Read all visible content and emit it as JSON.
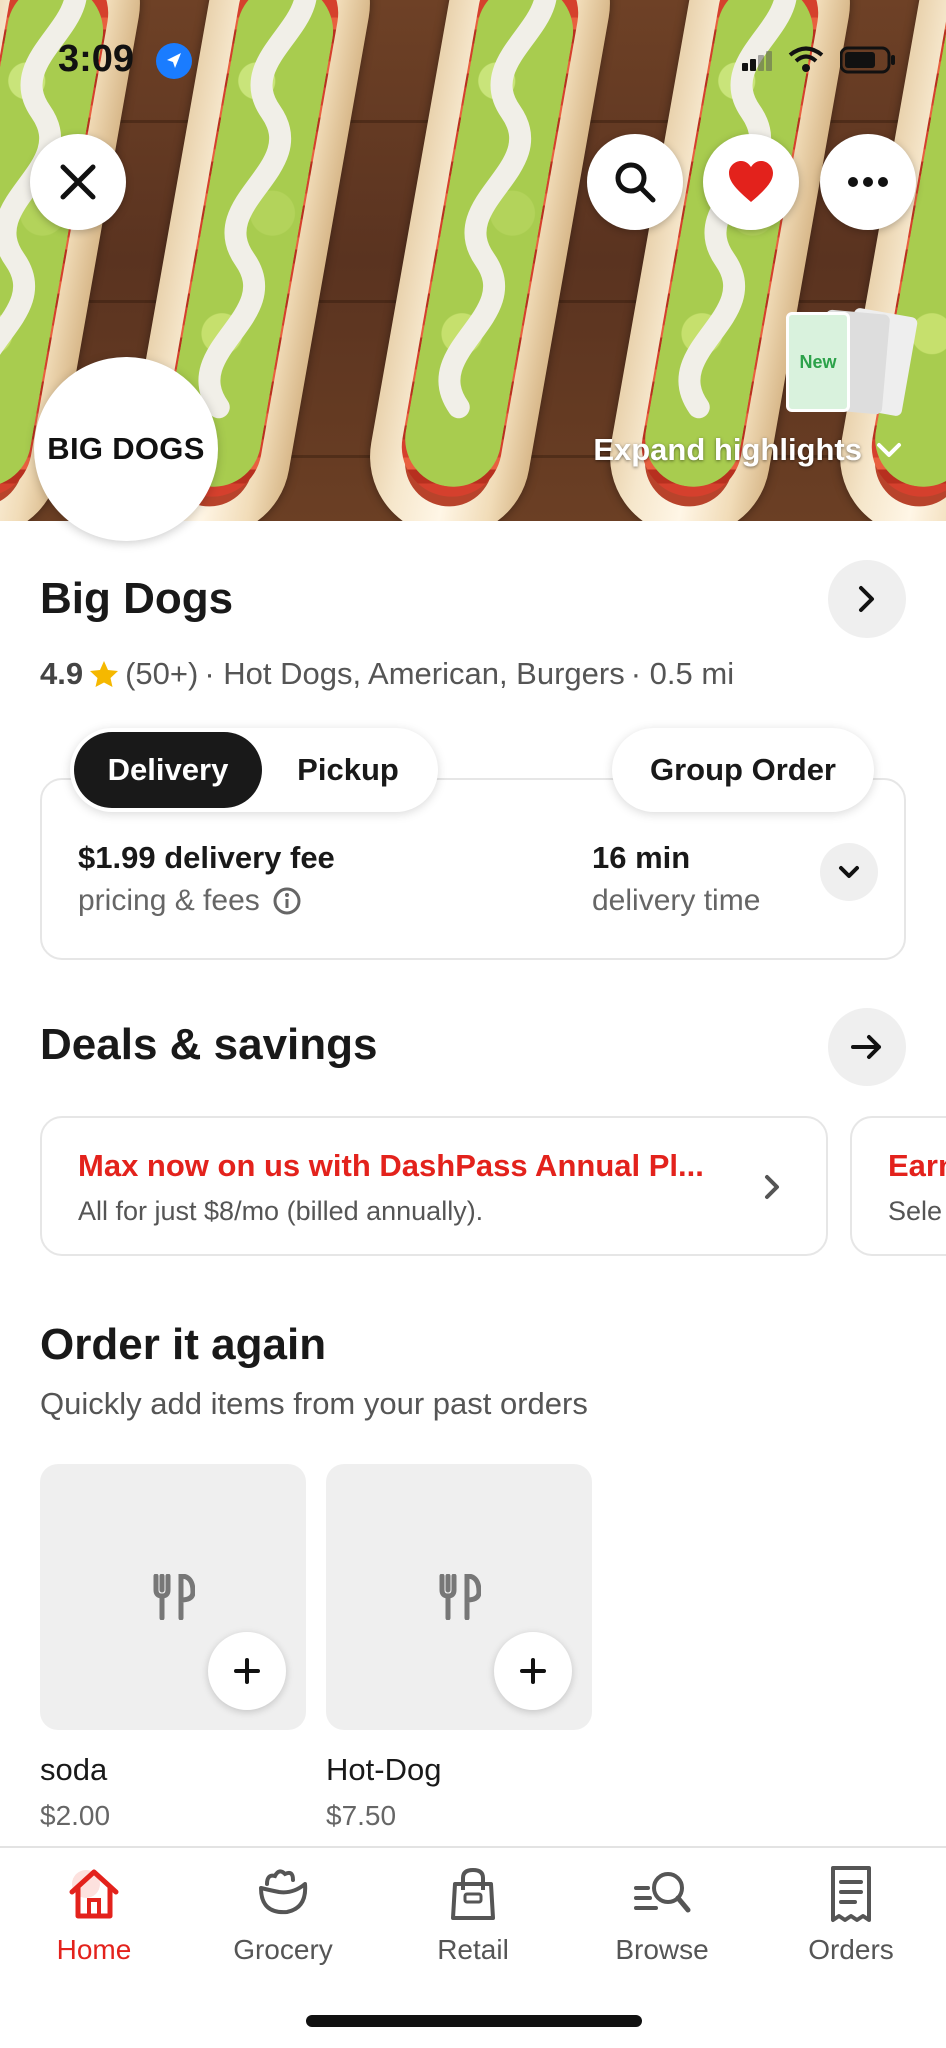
{
  "status_bar": {
    "time": "3:09"
  },
  "hero": {
    "close_icon": "close-icon",
    "search_icon": "search-icon",
    "favorite_icon": "heart-icon",
    "more_icon": "more-icon",
    "logo_text": "BIG DOGS",
    "new_badge": "New",
    "expand_label": "Expand highlights"
  },
  "store": {
    "name": "Big Dogs",
    "rating": "4.9",
    "reviews": "(50+)",
    "cuisines": "· Hot Dogs, American, Burgers",
    "distance": "· 0.5 mi"
  },
  "fulfillment": {
    "delivery_label": "Delivery",
    "pickup_label": "Pickup",
    "group_order_label": "Group Order",
    "fee": "$1.99 delivery fee",
    "fee_sub": "pricing & fees",
    "time": "16 min",
    "time_sub": "delivery time"
  },
  "deals": {
    "title": "Deals & savings",
    "cards": [
      {
        "title": "Max now on us with DashPass Annual Pl...",
        "subtitle": "All for just $8/mo (billed annually)."
      },
      {
        "title": "Earn",
        "subtitle": "Sele"
      }
    ]
  },
  "order_again": {
    "title": "Order it again",
    "subtitle": "Quickly add items from your past orders",
    "items": [
      {
        "name": "soda",
        "price": "$2.00"
      },
      {
        "name": "Hot-Dog",
        "price": "$7.50"
      }
    ]
  },
  "tabbar": {
    "tabs": [
      {
        "label": "Home",
        "icon": "home-icon",
        "active": true
      },
      {
        "label": "Grocery",
        "icon": "grocery-icon",
        "active": false
      },
      {
        "label": "Retail",
        "icon": "retail-bag-icon",
        "active": false
      },
      {
        "label": "Browse",
        "icon": "browse-search-icon",
        "active": false
      },
      {
        "label": "Orders",
        "icon": "receipt-icon",
        "active": false
      }
    ]
  },
  "colors": {
    "accent": "#e3221c",
    "dark": "#191919"
  }
}
